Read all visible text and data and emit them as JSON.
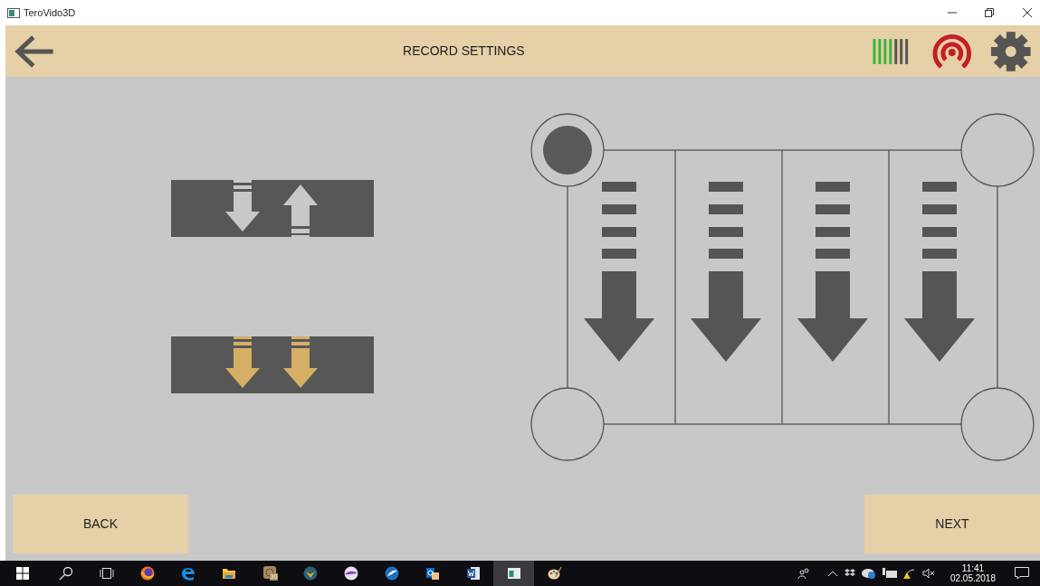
{
  "window": {
    "title": "TeroVido3D"
  },
  "header": {
    "title": "RECORD SETTINGS"
  },
  "modes": [
    {
      "kind": "opposite",
      "selected": false
    },
    {
      "kind": "same",
      "selected": true
    }
  ],
  "corners": [
    {
      "selected": true
    },
    {
      "selected": false
    },
    {
      "selected": false
    },
    {
      "selected": false
    }
  ],
  "buttons": [
    {
      "label": "BACK"
    },
    {
      "label": "NEXT"
    }
  ],
  "taskbar": {
    "badge": "30",
    "time": "11:41",
    "date": "02.05.2018"
  }
}
